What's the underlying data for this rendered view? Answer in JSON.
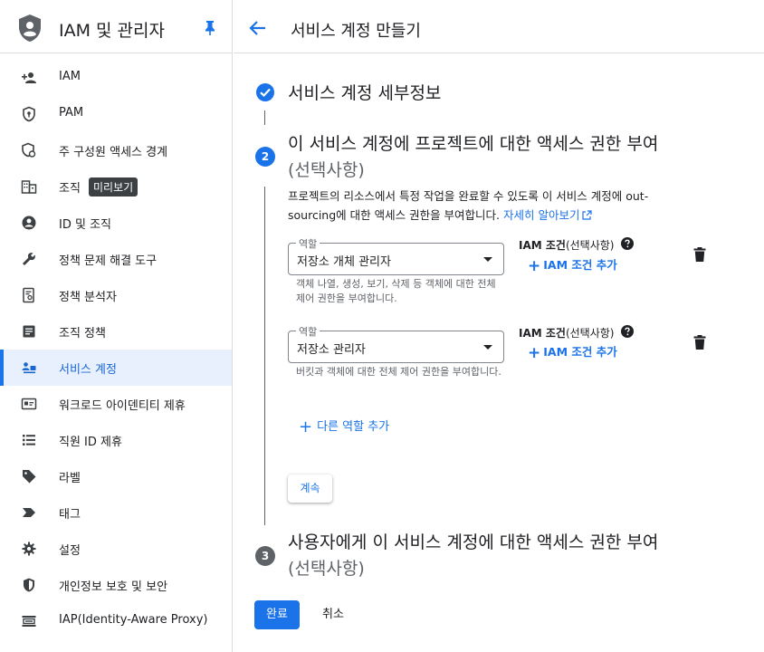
{
  "sidebar": {
    "title": "IAM 및 관리자",
    "items": [
      {
        "label": "IAM",
        "icon": "person-add-icon"
      },
      {
        "label": "PAM",
        "icon": "shield-key-icon"
      },
      {
        "label": "주 구성원 액세스 경계",
        "icon": "policy-boundary-icon"
      },
      {
        "label": "조직",
        "icon": "building-icon",
        "badge": "미리보기"
      },
      {
        "label": "ID 및 조직",
        "icon": "account-circle-icon"
      },
      {
        "label": "정책 문제 해결 도구",
        "icon": "wrench-icon"
      },
      {
        "label": "정책 분석자",
        "icon": "doc-search-icon"
      },
      {
        "label": "조직 정책",
        "icon": "list-doc-icon"
      },
      {
        "label": "서비스 계정",
        "icon": "service-account-icon",
        "active": true
      },
      {
        "label": "워크로드 아이덴티티 제휴",
        "icon": "id-card-icon"
      },
      {
        "label": "직원 ID 제휴",
        "icon": "list-icon"
      },
      {
        "label": "라벨",
        "icon": "tag-icon"
      },
      {
        "label": "태그",
        "icon": "chevron-tag-icon"
      },
      {
        "label": "설정",
        "icon": "gear-icon"
      },
      {
        "label": "개인정보 보호 및 보안",
        "icon": "shield-icon"
      },
      {
        "label": "IAP(Identity-Aware Proxy)",
        "icon": "iap-icon"
      }
    ]
  },
  "header": {
    "title": "서비스 계정 만들기"
  },
  "step1": {
    "title": "서비스 계정 세부정보"
  },
  "step2": {
    "number": "2",
    "title": "이 서비스 계정에 프로젝트에 대한 액세스 권한 부여",
    "optional": "(선택사항)",
    "description": "프로젝트의 리소스에서 특정 작업을 완료할 수 있도록 이 서비스 계정에 out-sourcing에 대한 액세스 권한을 부여합니다.",
    "learn_more": "자세히 알아보기",
    "roles": [
      {
        "legend": "역할",
        "value": "저장소 개체 관리자",
        "help": "객체 나열, 생성, 보기, 삭제 등 객체에 대한 전체 제어 권한을 부여합니다.",
        "condition_label": "IAM 조건",
        "condition_optional": "(선택사항)",
        "add_condition": "IAM 조건 추가"
      },
      {
        "legend": "역할",
        "value": "저장소 관리자",
        "help": "버킷과 객체에 대한 전체 제어 권한을 부여합니다.",
        "condition_label": "IAM 조건",
        "condition_optional": "(선택사항)",
        "add_condition": "IAM 조건 추가"
      }
    ],
    "add_role": "다른 역할 추가",
    "continue": "계속"
  },
  "step3": {
    "number": "3",
    "title": "사용자에게 이 서비스 계정에 대한 액세스 권한 부여",
    "optional": "(선택사항)"
  },
  "footer": {
    "done": "완료",
    "cancel": "취소"
  }
}
